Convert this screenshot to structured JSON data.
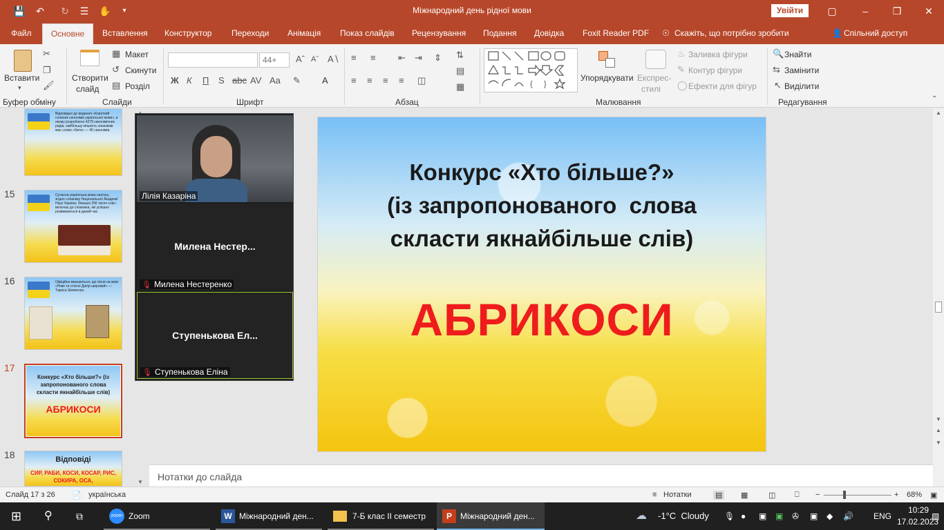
{
  "window": {
    "title": "Міжнародний день рідної мови",
    "signin_label": "Увійти"
  },
  "menu": {
    "items": [
      "Файл",
      "Основне",
      "Вставлення",
      "Конструктор",
      "Переходи",
      "Анімація",
      "Показ слайдів",
      "Рецензування",
      "Подання",
      "Довідка",
      "Foxit Reader PDF"
    ],
    "search": "Скажіть, що потрібно зробити",
    "share": "Спільний доступ"
  },
  "ribbon": {
    "clipboard": {
      "paste": "Вставити",
      "group": "Буфер обміну"
    },
    "slides": {
      "new_slide_1": "Створити",
      "new_slide_2": "слайд",
      "layout": "Макет",
      "reset": "Скинути",
      "section": "Розділ",
      "group": "Слайди"
    },
    "font": {
      "size_value": "44+",
      "group": "Шрифт",
      "bold": "Ж",
      "italic": "К",
      "underline": "П",
      "strike": "S",
      "spacing": "AV",
      "case": "Aa"
    },
    "paragraph": {
      "group": "Абзац"
    },
    "drawing": {
      "arrange": "Упорядкувати",
      "quick_styles_1": "Експрес-",
      "quick_styles_2": "стилі",
      "fill": "Заливка фігури",
      "outline": "Контур фігури",
      "effects": "Ефекти для фігур",
      "group": "Малювання"
    },
    "editing": {
      "find": "Знайти",
      "replace": "Замінити",
      "select": "Виділити",
      "group": "Редагування"
    }
  },
  "thumbnails": [
    {
      "num": "",
      "text": "Відповідно до видання «Короткий словник синонімів української мови», в якому розроблено 4279 синонімічних рядів, найбільшу кількість синонімів має слово «бити» — 45 синонімів."
    },
    {
      "num": "15",
      "text": "Сучасна українська мова налічує, згідно словнику Національної Академії Наук України, близько 256 тисяч слів і включає до словника, які успішно розвиваються в даний час."
    },
    {
      "num": "16",
      "text": "Офіційно визнаються, що пісня на мові «Реве та стогне Дніпр широкий» — Тараса Шевченка."
    },
    {
      "num": "17",
      "text_title": "Конкурс «Хто більше?» (із запропонованого слова скласти якнайбільше слів)",
      "text_word": "АБРИКОСИ"
    },
    {
      "num": "18",
      "text_title": "Відповіді",
      "text_word": "СИР, РАБИ, КОСИ, КОСАР, РИС, СОКИРА, ОСА,"
    }
  ],
  "slide": {
    "title_line1": "Конкурс «Хто більше?»",
    "title_line2": "(із запропонованого  слова",
    "title_line3": "скласти якнайбільше слів)",
    "word": "АБРИКОСИ"
  },
  "notes_placeholder": "Нотатки до слайда",
  "zoom": {
    "participants": [
      {
        "name": "Лілія Казаріна",
        "video": true
      },
      {
        "display": "Милена  Нестер...",
        "name": "Милена Нестеренко",
        "video": false
      },
      {
        "display": "Ступенькова  Ел...",
        "name": "Ступенькова Еліна",
        "video": false
      }
    ]
  },
  "status": {
    "slide_counter": "Слайд 17 з 26",
    "language": "українська",
    "notes": "Нотатки",
    "zoom": "68%"
  },
  "taskbar": {
    "zoom_app": "Zoom",
    "word_app": "Міжнародний ден...",
    "folder_app": "7-Б клас ІІ семестр",
    "ppt_app": "Міжнародний ден...",
    "weather": "-1°C  Cloudy",
    "lang": "ENG",
    "time": "10:29",
    "date": "17.02.2023"
  },
  "colors": {
    "accent": "#b7472a",
    "slide_word": "#ee1c1c"
  }
}
